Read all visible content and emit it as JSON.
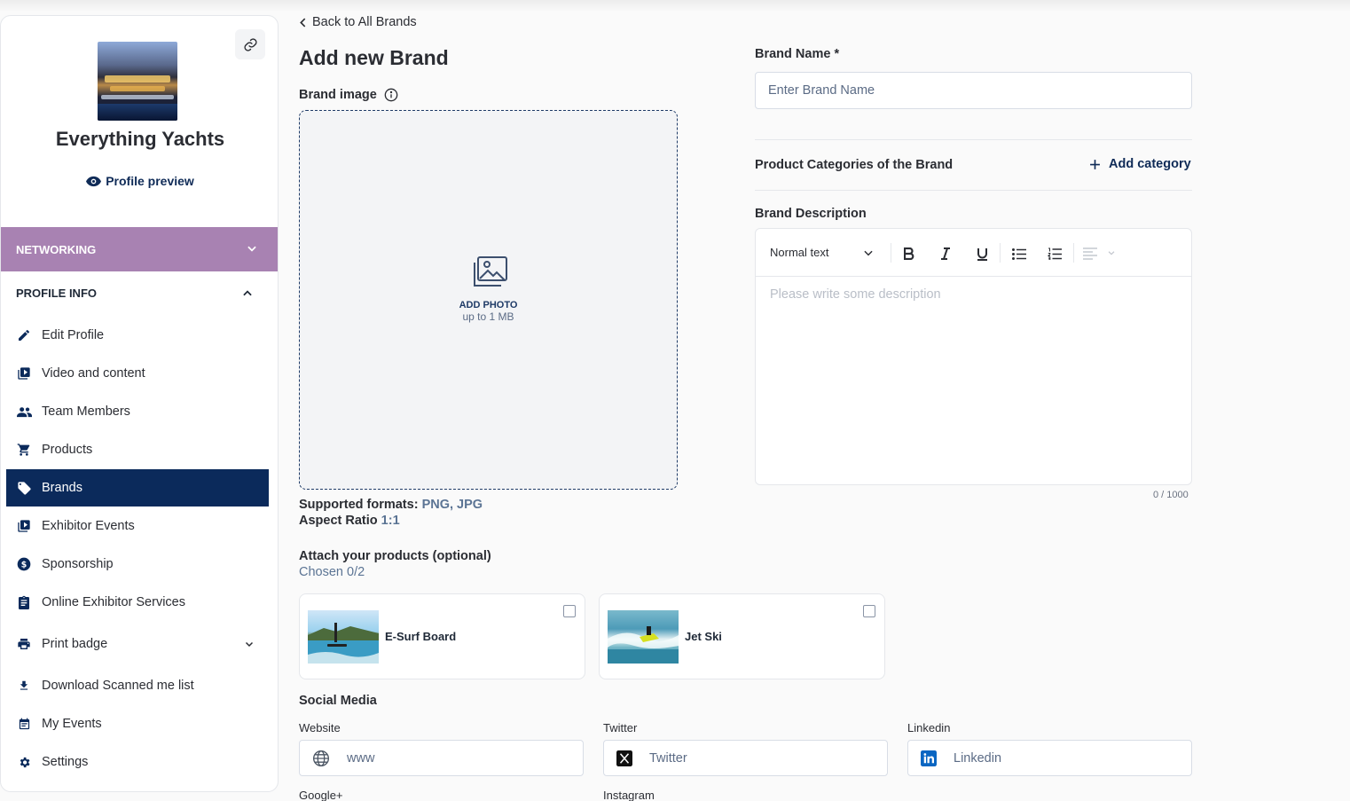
{
  "sidebar": {
    "company_name": "Everything Yachts",
    "profile_preview": "Profile preview",
    "networking": "NETWORKING",
    "profile_info": "PROFILE INFO",
    "items": [
      {
        "label": "Edit Profile",
        "icon": "pencil-icon"
      },
      {
        "label": "Video and content",
        "icon": "video-library-icon"
      },
      {
        "label": "Team Members",
        "icon": "people-icon"
      },
      {
        "label": "Products",
        "icon": "cart-icon"
      },
      {
        "label": "Brands",
        "icon": "tag-icon",
        "active": true
      },
      {
        "label": "Exhibitor Events",
        "icon": "events-library-icon"
      },
      {
        "label": "Sponsorship",
        "icon": "dollar-icon"
      },
      {
        "label": "Online Exhibitor Services",
        "icon": "clipboard-icon"
      },
      {
        "label": "Print badge",
        "icon": "printer-icon"
      },
      {
        "label": "Download Scanned me list",
        "icon": "download-icon"
      },
      {
        "label": "My Events",
        "icon": "calendar-icon"
      },
      {
        "label": "Settings",
        "icon": "gear-icon"
      }
    ]
  },
  "main": {
    "back_link": "Back to All Brands",
    "title": "Add new Brand",
    "brand_image_label": "Brand image",
    "dropzone": {
      "title": "ADD PHOTO",
      "subtitle": "up to 1 MB"
    },
    "formats_label": "Supported formats:",
    "formats_value": "PNG, JPG",
    "aspect_label": "Aspect Ratio",
    "aspect_value": "1:1",
    "attach_title": "Attach your products (optional)",
    "chosen": "Chosen 0/2",
    "products": [
      {
        "name": "E-Surf Board",
        "checked": false
      },
      {
        "name": "Jet Ski",
        "checked": false
      }
    ],
    "social": {
      "title": "Social Media",
      "website_label": "Website",
      "website_placeholder": "www",
      "twitter_label": "Twitter",
      "twitter_placeholder": "Twitter",
      "linkedin_label": "Linkedin",
      "linkedin_placeholder": "Linkedin",
      "googleplus_label": "Google+",
      "instagram_label": "Instagram"
    }
  },
  "form": {
    "brand_name_label": "Brand Name *",
    "brand_name_placeholder": "Enter Brand Name",
    "categories_label": "Product Categories of the Brand",
    "add_category": "Add category",
    "description_label": "Brand Description",
    "text_style": "Normal text",
    "description_placeholder": "Please write some description",
    "counter": "0 / 1000"
  },
  "colors": {
    "navy": "#0b2a5b",
    "networking": "#a882b2",
    "link_accent": "#5b7494"
  }
}
